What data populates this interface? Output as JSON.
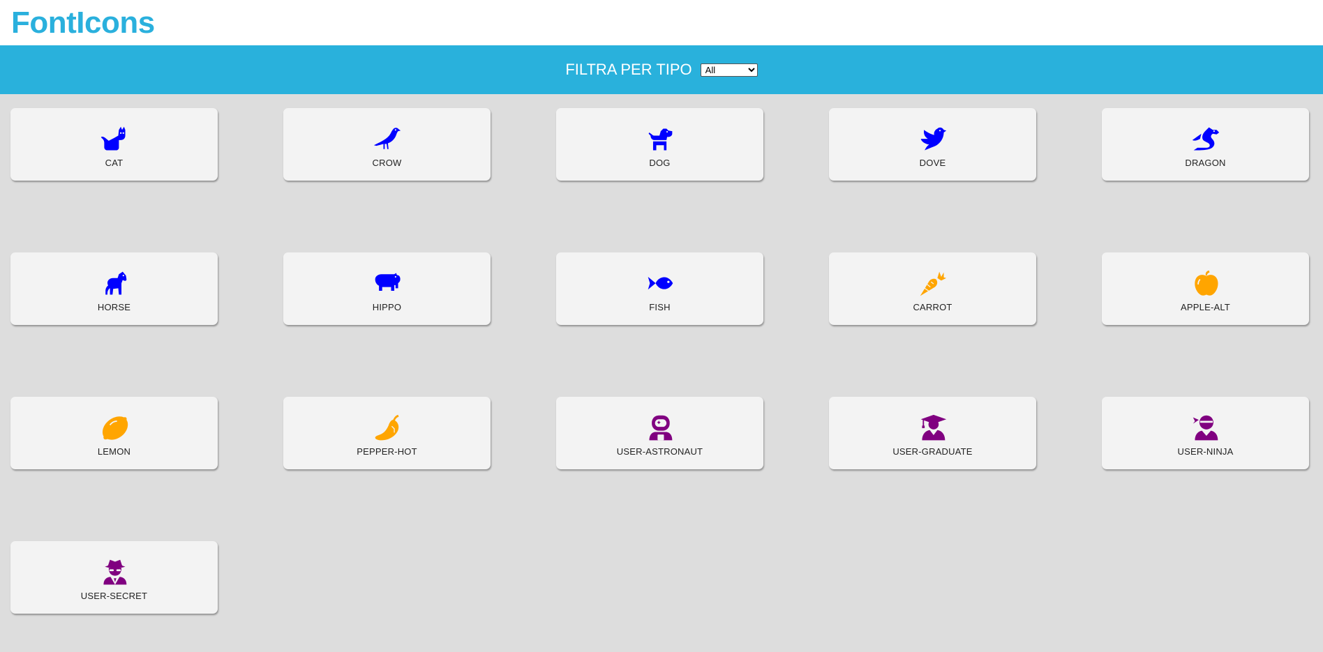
{
  "app": {
    "title": "FontIcons"
  },
  "filter": {
    "label": "FILTRA PER TIPO",
    "selected": "All",
    "options": [
      "All"
    ]
  },
  "colors": {
    "animal": "#0000ff",
    "food": "#ffa500",
    "people": "#800080",
    "brand": "#2ab0dd"
  },
  "icons": [
    {
      "name": "CAT",
      "icon": "cat-icon",
      "type": "animal"
    },
    {
      "name": "CROW",
      "icon": "crow-icon",
      "type": "animal"
    },
    {
      "name": "DOG",
      "icon": "dog-icon",
      "type": "animal"
    },
    {
      "name": "DOVE",
      "icon": "dove-icon",
      "type": "animal"
    },
    {
      "name": "DRAGON",
      "icon": "dragon-icon",
      "type": "animal"
    },
    {
      "name": "HORSE",
      "icon": "horse-icon",
      "type": "animal"
    },
    {
      "name": "HIPPO",
      "icon": "hippo-icon",
      "type": "animal"
    },
    {
      "name": "FISH",
      "icon": "fish-icon",
      "type": "animal"
    },
    {
      "name": "CARROT",
      "icon": "carrot-icon",
      "type": "food"
    },
    {
      "name": "APPLE-ALT",
      "icon": "apple-alt-icon",
      "type": "food"
    },
    {
      "name": "LEMON",
      "icon": "lemon-icon",
      "type": "food"
    },
    {
      "name": "PEPPER-HOT",
      "icon": "pepper-hot-icon",
      "type": "food"
    },
    {
      "name": "USER-ASTRONAUT",
      "icon": "user-astronaut-icon",
      "type": "people"
    },
    {
      "name": "USER-GRADUATE",
      "icon": "user-graduate-icon",
      "type": "people"
    },
    {
      "name": "USER-NINJA",
      "icon": "user-ninja-icon",
      "type": "people"
    },
    {
      "name": "USER-SECRET",
      "icon": "user-secret-icon",
      "type": "people"
    }
  ]
}
